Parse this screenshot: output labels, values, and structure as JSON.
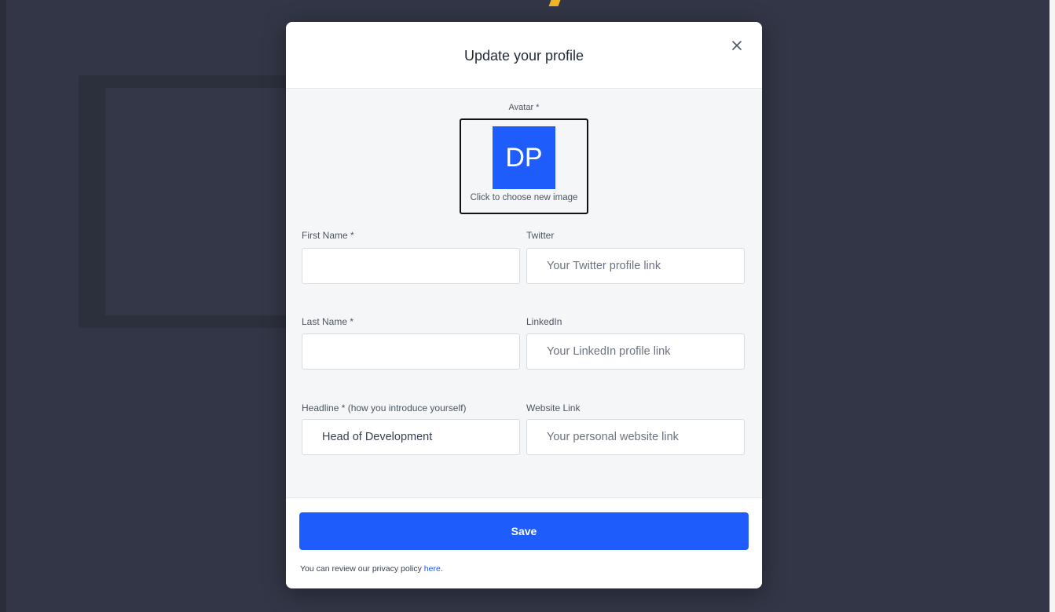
{
  "background_page": {
    "accent_color": "#f0b429"
  },
  "modal": {
    "title": "Update your profile",
    "close_icon": "close-icon",
    "avatar": {
      "label": "Avatar *",
      "initials": "DP",
      "hint": "Click to choose new image",
      "tile_color": "#1e5cfb"
    },
    "fields": {
      "first_name": {
        "label": "First Name *",
        "value": "",
        "placeholder": ""
      },
      "twitter": {
        "label": "Twitter",
        "value": "",
        "placeholder": "Your Twitter profile link"
      },
      "last_name": {
        "label": "Last Name *",
        "value": "",
        "placeholder": ""
      },
      "linkedin": {
        "label": "LinkedIn",
        "value": "",
        "placeholder": "Your LinkedIn profile link"
      },
      "headline": {
        "label": "Headline * (how you introduce yourself)",
        "value": "Head of Development",
        "placeholder": ""
      },
      "website": {
        "label": "Website Link",
        "value": "",
        "placeholder": "Your personal website link"
      }
    },
    "save_label": "Save",
    "privacy_text": "You can review our privacy policy ",
    "privacy_link": "here",
    "privacy_suffix": "."
  },
  "colors": {
    "primary": "#1e5cfb",
    "overlay": "#323646"
  }
}
